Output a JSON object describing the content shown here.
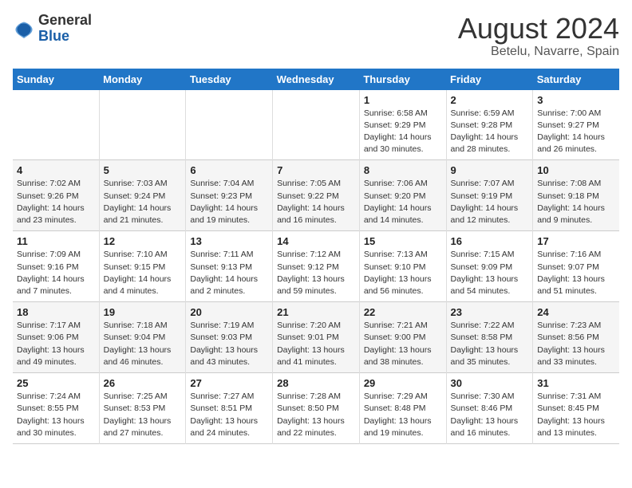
{
  "header": {
    "logo_general": "General",
    "logo_blue": "Blue",
    "title": "August 2024",
    "subtitle": "Betelu, Navarre, Spain"
  },
  "calendar": {
    "days_of_week": [
      "Sunday",
      "Monday",
      "Tuesday",
      "Wednesday",
      "Thursday",
      "Friday",
      "Saturday"
    ],
    "weeks": [
      [
        {
          "num": "",
          "info": ""
        },
        {
          "num": "",
          "info": ""
        },
        {
          "num": "",
          "info": ""
        },
        {
          "num": "",
          "info": ""
        },
        {
          "num": "1",
          "info": "Sunrise: 6:58 AM\nSunset: 9:29 PM\nDaylight: 14 hours\nand 30 minutes."
        },
        {
          "num": "2",
          "info": "Sunrise: 6:59 AM\nSunset: 9:28 PM\nDaylight: 14 hours\nand 28 minutes."
        },
        {
          "num": "3",
          "info": "Sunrise: 7:00 AM\nSunset: 9:27 PM\nDaylight: 14 hours\nand 26 minutes."
        }
      ],
      [
        {
          "num": "4",
          "info": "Sunrise: 7:02 AM\nSunset: 9:26 PM\nDaylight: 14 hours\nand 23 minutes."
        },
        {
          "num": "5",
          "info": "Sunrise: 7:03 AM\nSunset: 9:24 PM\nDaylight: 14 hours\nand 21 minutes."
        },
        {
          "num": "6",
          "info": "Sunrise: 7:04 AM\nSunset: 9:23 PM\nDaylight: 14 hours\nand 19 minutes."
        },
        {
          "num": "7",
          "info": "Sunrise: 7:05 AM\nSunset: 9:22 PM\nDaylight: 14 hours\nand 16 minutes."
        },
        {
          "num": "8",
          "info": "Sunrise: 7:06 AM\nSunset: 9:20 PM\nDaylight: 14 hours\nand 14 minutes."
        },
        {
          "num": "9",
          "info": "Sunrise: 7:07 AM\nSunset: 9:19 PM\nDaylight: 14 hours\nand 12 minutes."
        },
        {
          "num": "10",
          "info": "Sunrise: 7:08 AM\nSunset: 9:18 PM\nDaylight: 14 hours\nand 9 minutes."
        }
      ],
      [
        {
          "num": "11",
          "info": "Sunrise: 7:09 AM\nSunset: 9:16 PM\nDaylight: 14 hours\nand 7 minutes."
        },
        {
          "num": "12",
          "info": "Sunrise: 7:10 AM\nSunset: 9:15 PM\nDaylight: 14 hours\nand 4 minutes."
        },
        {
          "num": "13",
          "info": "Sunrise: 7:11 AM\nSunset: 9:13 PM\nDaylight: 14 hours\nand 2 minutes."
        },
        {
          "num": "14",
          "info": "Sunrise: 7:12 AM\nSunset: 9:12 PM\nDaylight: 13 hours\nand 59 minutes."
        },
        {
          "num": "15",
          "info": "Sunrise: 7:13 AM\nSunset: 9:10 PM\nDaylight: 13 hours\nand 56 minutes."
        },
        {
          "num": "16",
          "info": "Sunrise: 7:15 AM\nSunset: 9:09 PM\nDaylight: 13 hours\nand 54 minutes."
        },
        {
          "num": "17",
          "info": "Sunrise: 7:16 AM\nSunset: 9:07 PM\nDaylight: 13 hours\nand 51 minutes."
        }
      ],
      [
        {
          "num": "18",
          "info": "Sunrise: 7:17 AM\nSunset: 9:06 PM\nDaylight: 13 hours\nand 49 minutes."
        },
        {
          "num": "19",
          "info": "Sunrise: 7:18 AM\nSunset: 9:04 PM\nDaylight: 13 hours\nand 46 minutes."
        },
        {
          "num": "20",
          "info": "Sunrise: 7:19 AM\nSunset: 9:03 PM\nDaylight: 13 hours\nand 43 minutes."
        },
        {
          "num": "21",
          "info": "Sunrise: 7:20 AM\nSunset: 9:01 PM\nDaylight: 13 hours\nand 41 minutes."
        },
        {
          "num": "22",
          "info": "Sunrise: 7:21 AM\nSunset: 9:00 PM\nDaylight: 13 hours\nand 38 minutes."
        },
        {
          "num": "23",
          "info": "Sunrise: 7:22 AM\nSunset: 8:58 PM\nDaylight: 13 hours\nand 35 minutes."
        },
        {
          "num": "24",
          "info": "Sunrise: 7:23 AM\nSunset: 8:56 PM\nDaylight: 13 hours\nand 33 minutes."
        }
      ],
      [
        {
          "num": "25",
          "info": "Sunrise: 7:24 AM\nSunset: 8:55 PM\nDaylight: 13 hours\nand 30 minutes."
        },
        {
          "num": "26",
          "info": "Sunrise: 7:25 AM\nSunset: 8:53 PM\nDaylight: 13 hours\nand 27 minutes."
        },
        {
          "num": "27",
          "info": "Sunrise: 7:27 AM\nSunset: 8:51 PM\nDaylight: 13 hours\nand 24 minutes."
        },
        {
          "num": "28",
          "info": "Sunrise: 7:28 AM\nSunset: 8:50 PM\nDaylight: 13 hours\nand 22 minutes."
        },
        {
          "num": "29",
          "info": "Sunrise: 7:29 AM\nSunset: 8:48 PM\nDaylight: 13 hours\nand 19 minutes."
        },
        {
          "num": "30",
          "info": "Sunrise: 7:30 AM\nSunset: 8:46 PM\nDaylight: 13 hours\nand 16 minutes."
        },
        {
          "num": "31",
          "info": "Sunrise: 7:31 AM\nSunset: 8:45 PM\nDaylight: 13 hours\nand 13 minutes."
        }
      ]
    ]
  }
}
